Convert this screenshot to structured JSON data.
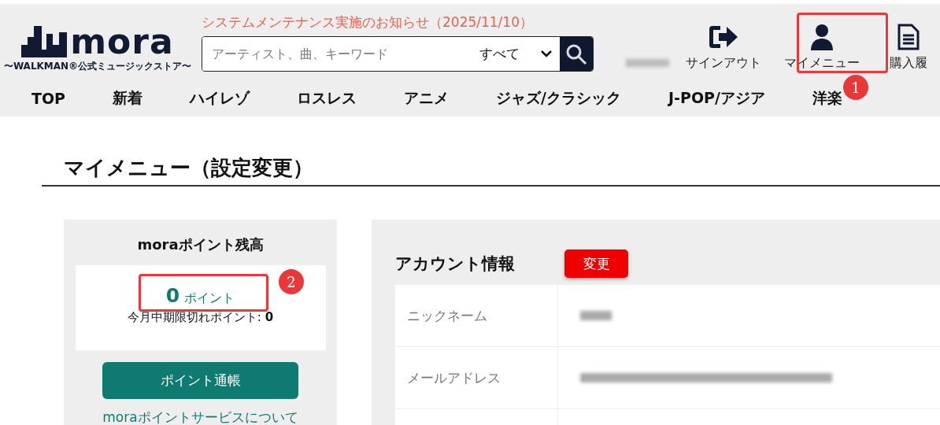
{
  "header": {
    "logo": {
      "wordmark": "mora",
      "tagline": "〜WALKMAN®公式ミュージックストア〜"
    },
    "notice": "システムメンテナンス実施のお知らせ（2025/11/10）",
    "search": {
      "placeholder": "アーティスト、曲、キーワード",
      "category": "すべて"
    },
    "actions": [
      {
        "kind": "signout",
        "label": "サインアウト"
      },
      {
        "kind": "user",
        "label": "マイメニュー"
      },
      {
        "kind": "document",
        "label": "購入履"
      }
    ]
  },
  "nav": [
    {
      "label": "TOP"
    },
    {
      "label": "新着"
    },
    {
      "label": "ハイレゾ"
    },
    {
      "label": "ロスレス"
    },
    {
      "label": "アニメ"
    },
    {
      "label": "ジャズ/クラシック"
    },
    {
      "label": "J-POP/アジア"
    },
    {
      "label": "洋楽"
    }
  ],
  "page_title": "マイメニュー（設定変更）",
  "points": {
    "title": "moraポイント残高",
    "amount": "0",
    "unit": "ポイント",
    "expiring": "今月中期限切れポイント: **0**",
    "button": "ポイント通帳",
    "link": "moraポイントサービスについて"
  },
  "account": {
    "title": "アカウント情報",
    "edit_button": "変更",
    "rows": [
      {
        "label": "ニックネーム"
      },
      {
        "label": "メールアドレス"
      }
    ]
  },
  "annotations": [
    {
      "number": "1"
    },
    {
      "number": "2"
    }
  ]
}
